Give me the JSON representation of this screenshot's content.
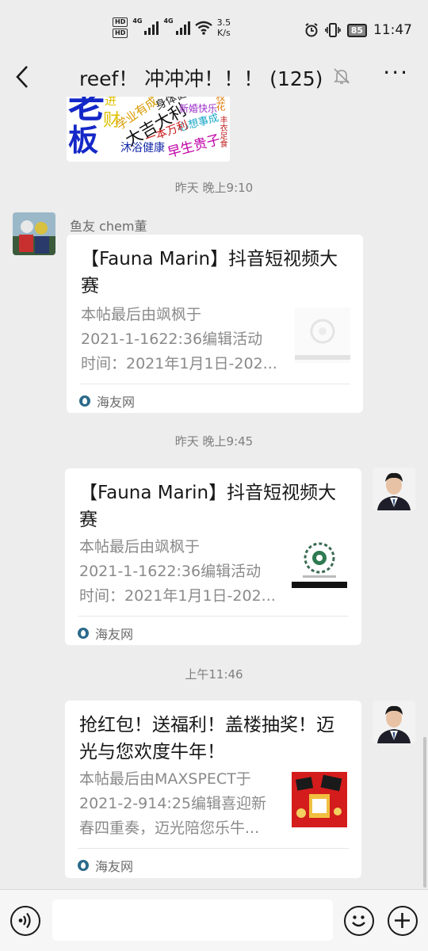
{
  "status_bar": {
    "hd1": "HD",
    "hd2": "HD",
    "net1": "4G",
    "net2": "4G",
    "speed_value": "3.5",
    "speed_unit": "K/s",
    "battery": "85",
    "time": "11:47",
    "icons": [
      "signal-icon",
      "wifi-icon",
      "alarm-icon",
      "vibrate-icon",
      "battery-icon"
    ]
  },
  "titlebar": {
    "title": "reef！ 冲冲冲！！！ (125)",
    "back_icon": "chevron-left-icon",
    "mute_icon": "bell-off-icon",
    "more_icon": "more-dots-icon"
  },
  "sticker": {
    "words": [
      "老",
      "板",
      "进",
      "财",
      "学业有成",
      "大吉大利",
      "身体健康",
      "新婚快乐",
      "心想事成",
      "一本万利",
      "沐浴健康",
      "早生贵子",
      "校花",
      "丰衣足食",
      "事",
      "成"
    ]
  },
  "messages": [
    {
      "timestamp": "昨天 晚上9:10"
    },
    {
      "sender": "鱼友 chem董",
      "title": "【Fauna Marin】抖音短视频大赛",
      "desc_lines": [
        "本帖最后由飒枫于",
        "2021-1-1622:36编辑活动",
        "时间：2021年1月1日-202..."
      ],
      "source": "海友网"
    },
    {
      "timestamp": "昨天 晚上9:45"
    },
    {
      "title": "【Fauna Marin】抖音短视频大赛",
      "desc_lines": [
        "本帖最后由飒枫于",
        "2021-1-1622:36编辑活动",
        "时间：2021年1月1日-202..."
      ],
      "source": "海友网"
    },
    {
      "timestamp": "上午11:46"
    },
    {
      "title": "抢红包！送福利！盖楼抽奖！迈光与您欢度牛年！",
      "desc_lines": [
        "本帖最后由MAXSPECT于",
        "2021-2-914:25编辑喜迎新",
        "春四重奏，迈光陪您乐牛..."
      ],
      "source": "海友网"
    }
  ],
  "input_bar": {
    "voice_icon": "voice-icon",
    "placeholder": "",
    "emoji_icon": "emoji-icon",
    "plus_icon": "plus-icon"
  }
}
